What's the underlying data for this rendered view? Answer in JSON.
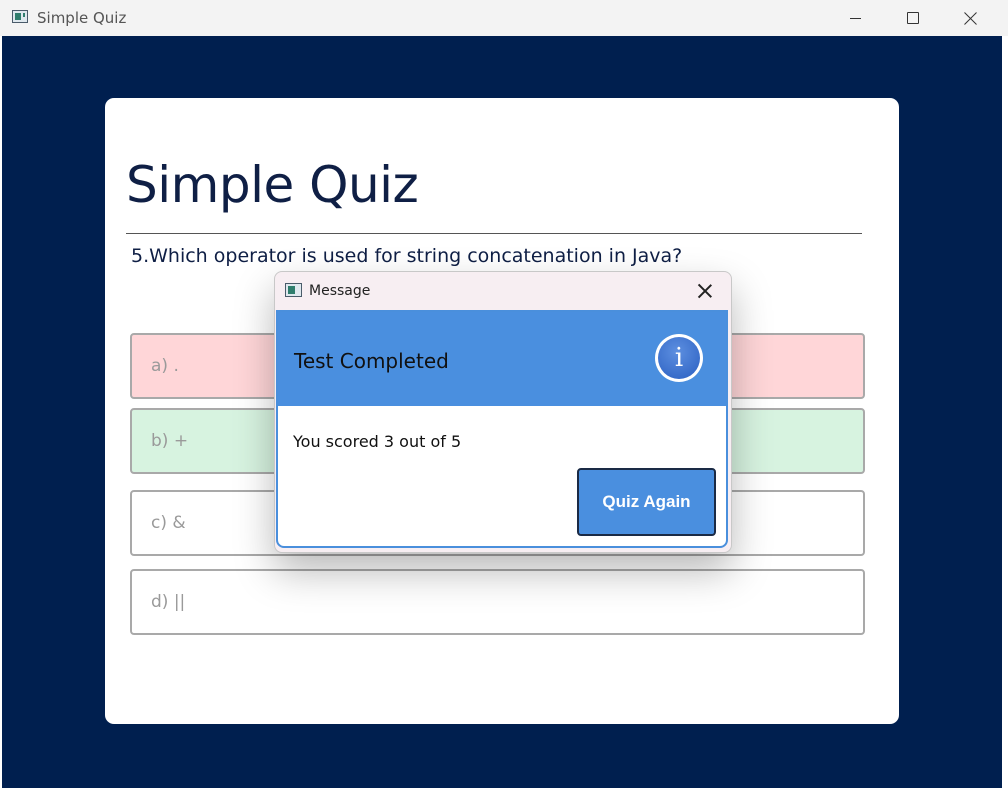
{
  "window": {
    "title": "Simple Quiz"
  },
  "quiz": {
    "heading": "Simple Quiz",
    "question": "5.Which operator is used for string concatenation in Java?",
    "options": [
      {
        "label": "a) .",
        "state": "incorrect"
      },
      {
        "label": "b) +",
        "state": "correct"
      },
      {
        "label": "c) &",
        "state": "neutral"
      },
      {
        "label": "d) ||",
        "state": "neutral"
      }
    ]
  },
  "dialog": {
    "title": "Message",
    "heading": "Test Completed",
    "message": "You scored 3 out of 5",
    "button_label": "Quiz Again",
    "info_glyph": "i"
  },
  "colors": {
    "background": "#001f4f",
    "accent": "#4a8fdf",
    "incorrect": "#ffd6d8",
    "correct": "#d7f3e0"
  }
}
